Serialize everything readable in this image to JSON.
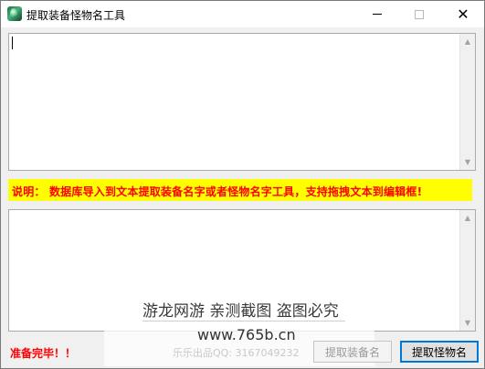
{
  "window": {
    "title": "提取装备怪物名工具",
    "minimize_glyph": "",
    "maximize_glyph": "",
    "close_glyph": "✕"
  },
  "info": {
    "text": "说明： 数据库导入到文本提取装备名字或者怪物名字工具，支持拖拽文本到编辑框!"
  },
  "scrollbar": {
    "up_glyph": "▲",
    "down_glyph": "▼"
  },
  "watermark": {
    "line1": "游龙网游 亲测截图 盗图必究",
    "line2": "www.765b.cn"
  },
  "status": {
    "text": "准备完毕！！",
    "credit": "乐乐出品QQ: 3167049232"
  },
  "buttons": {
    "extract_equipment": "提取装备名",
    "extract_monster": "提取怪物名"
  },
  "colors": {
    "info_background": "#ffff00",
    "info_text": "#ff0000",
    "status_text": "#ff0000",
    "focus_border": "#0078d7"
  },
  "icons": {
    "app": "app-icon",
    "minimize": "minimize-icon",
    "maximize": "maximize-icon",
    "close": "close-icon"
  }
}
